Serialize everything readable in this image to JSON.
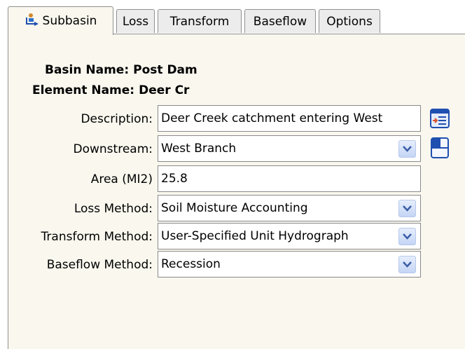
{
  "tabs": [
    {
      "label": "Subbasin",
      "active": true,
      "icon": "subbasin-icon"
    },
    {
      "label": "Loss",
      "active": false
    },
    {
      "label": "Transform",
      "active": false
    },
    {
      "label": "Baseflow",
      "active": false
    },
    {
      "label": "Options",
      "active": false
    }
  ],
  "basin": {
    "label": "Basin Name:",
    "value": "Post Dam"
  },
  "element": {
    "label": "Element Name:",
    "value": "Deer Cr"
  },
  "fields": {
    "description": {
      "label": "Description:",
      "value": "Deer Creek catchment entering West"
    },
    "downstream": {
      "label": "Downstream:",
      "value": "West Branch"
    },
    "area": {
      "label": "Area (MI2)",
      "value": "25.8"
    },
    "loss_method": {
      "label": "Loss Method:",
      "value": "Soil Moisture Accounting"
    },
    "transform_method": {
      "label": "Transform Method:",
      "value": "User-Specified Unit Hydrograph"
    },
    "baseflow_method": {
      "label": "Baseflow Method:",
      "value": "Recession"
    }
  },
  "side_buttons": {
    "description_editor": {
      "icon": "description-editor-icon"
    },
    "downstream_select": {
      "icon": "downstream-select-icon"
    }
  },
  "colors": {
    "panel_bg": "#f9f7ee",
    "tab_bg": "#ececec",
    "dropdown_arrow": "#3d5fa8",
    "icon_blue": "#1f4fb0"
  }
}
